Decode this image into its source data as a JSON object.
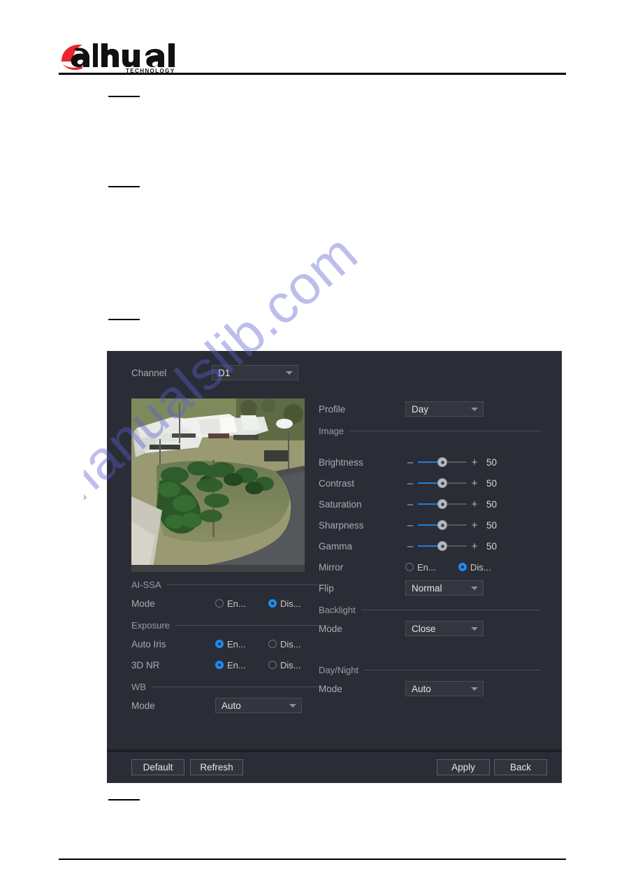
{
  "document": {
    "brand": "alhua",
    "brand_sub": "TECHNOLOGY",
    "watermark": "manualslib.com"
  },
  "dialog": {
    "channel": {
      "label": "Channel",
      "value": "D1"
    },
    "preview": {
      "alt": "aerial camera preview of building and garden"
    },
    "left": {
      "aissa": {
        "heading": "AI-SSA",
        "mode_label": "Mode",
        "options": [
          "En...",
          "Dis..."
        ],
        "selected": "Dis..."
      },
      "exposure": {
        "heading": "Exposure",
        "auto_iris_label": "Auto Iris",
        "auto_iris_options": [
          "En...",
          "Dis..."
        ],
        "auto_iris_selected": "En...",
        "nr_label": "3D NR",
        "nr_options": [
          "En...",
          "Dis..."
        ],
        "nr_selected": "En..."
      },
      "wb": {
        "heading": "WB",
        "mode_label": "Mode",
        "mode_value": "Auto"
      }
    },
    "right": {
      "profile_label": "Profile",
      "profile_value": "Day",
      "image_heading": "Image",
      "sliders": [
        {
          "label": "Brightness",
          "value": "50",
          "percent": 50
        },
        {
          "label": "Contrast",
          "value": "50",
          "percent": 50
        },
        {
          "label": "Saturation",
          "value": "50",
          "percent": 50
        },
        {
          "label": "Sharpness",
          "value": "50",
          "percent": 50
        },
        {
          "label": "Gamma",
          "value": "50",
          "percent": 50
        }
      ],
      "minus": "–",
      "plus": "+",
      "mirror": {
        "label": "Mirror",
        "options": [
          "En...",
          "Dis..."
        ],
        "selected": "Dis..."
      },
      "flip": {
        "label": "Flip",
        "value": "Normal"
      },
      "backlight": {
        "heading": "Backlight",
        "mode_label": "Mode",
        "mode_value": "Close"
      },
      "daynight": {
        "heading": "Day/Night",
        "mode_label": "Mode",
        "mode_value": "Auto"
      }
    },
    "footer": {
      "default": "Default",
      "refresh": "Refresh",
      "apply": "Apply",
      "back": "Back"
    }
  },
  "colors": {
    "dialog_bg": "#2b2d36",
    "accent_blue": "#1b8cf0",
    "slider_blue": "#1f7fd8",
    "brand_red": "#e8262b"
  }
}
